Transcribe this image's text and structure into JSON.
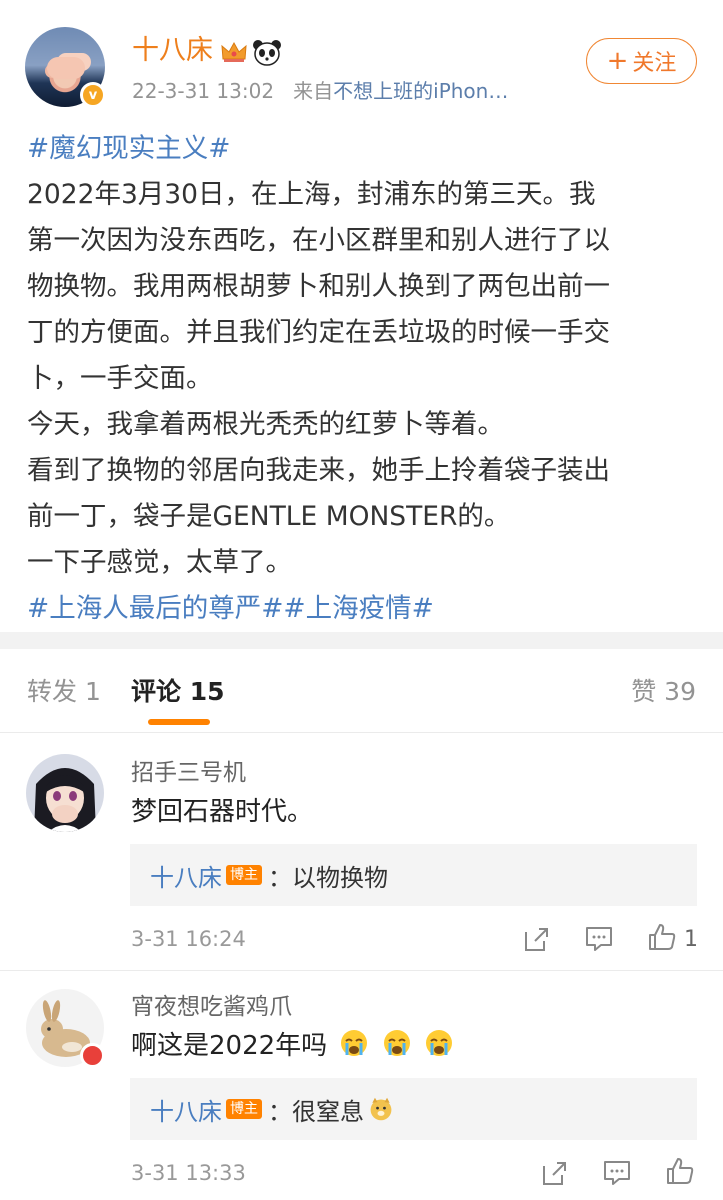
{
  "post": {
    "username": "十八床",
    "timestamp": "22-3-31 13:02",
    "source_prefix": "来自",
    "source": "不想上班的iPhon…",
    "follow_label": "关注",
    "hashtag_top": "#魔幻现实主义#",
    "body_lines": [
      " 2022年3月30日，在上海，封浦东的第三天。我",
      "第一次因为没东西吃，在小区群里和别人进行了以",
      "物换物。我用两根胡萝卜和别人换到了两包出前一",
      "丁的方便面。并且我们约定在丢垃圾的时候一手交",
      "卜，一手交面。",
      "今天，我拿着两根光秃秃的红萝卜等着。",
      "看到了换物的邻居向我走来，她手上拎着袋子装出",
      "前一丁，袋子是GENTLE MONSTER的。",
      "一下子感觉，太草了。"
    ],
    "hashtag_bottom": "#上海人最后的尊严##上海疫情#"
  },
  "tabs": {
    "repost": "转发 1",
    "comments": "评论 15",
    "likes": "赞 39"
  },
  "comments": [
    {
      "name": "招手三号机",
      "text": "梦回石器时代。",
      "reply_author": "十八床",
      "reply_tag": "博主",
      "reply_text": "：以物换物",
      "time": "3-31 16:24",
      "like_count": "1"
    },
    {
      "name": "宵夜想吃酱鸡爪",
      "text": "啊这是2022年吗",
      "reply_author": "十八床",
      "reply_tag": "博主",
      "reply_text": "：很窒息",
      "time": "3-31 13:33",
      "like_count": ""
    }
  ],
  "colors": {
    "accent": "#ff8200",
    "link": "#4a7ec0",
    "username": "#ee7f1c"
  }
}
